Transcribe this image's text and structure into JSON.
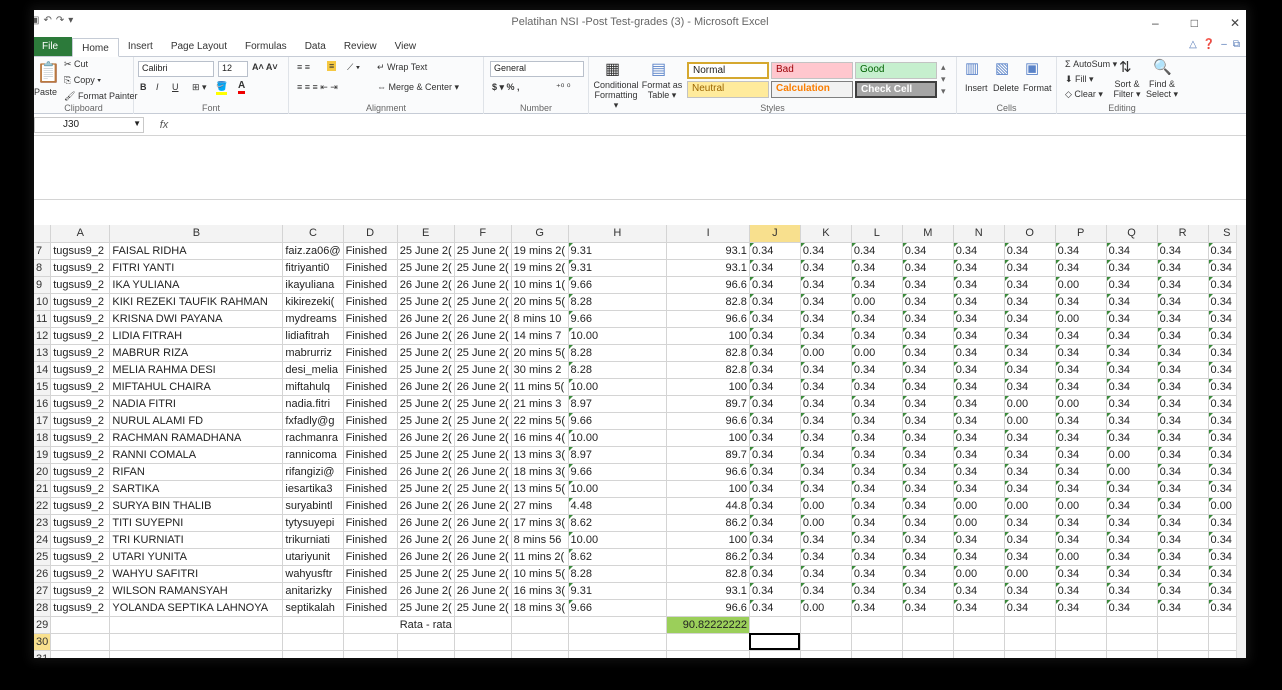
{
  "window": {
    "title": "Pelatihan NSI -Post Test-grades (3) - Microsoft Excel",
    "controls": [
      "–",
      "□",
      "✕"
    ]
  },
  "tabs": [
    "File",
    "Home",
    "Insert",
    "Page Layout",
    "Formulas",
    "Data",
    "Review",
    "View"
  ],
  "active_tab": "Home",
  "ribbon": {
    "clipboard": {
      "paste": "Paste",
      "cut": "Cut",
      "copy": "Copy ▾",
      "format_painter": "Format Painter",
      "label": "Clipboard"
    },
    "font": {
      "name": "Calibri",
      "size": "12",
      "label": "Font",
      "bold": "B",
      "italic": "I",
      "underline": "U"
    },
    "alignment": {
      "wrap": "Wrap Text",
      "merge": "Merge & Center ▾",
      "label": "Alignment"
    },
    "number": {
      "format": "General",
      "currency": "$ ▾  %  ,",
      "label": "Number"
    },
    "styles": {
      "cond": "Conditional Formatting ▾",
      "table": "Format as Table ▾",
      "normal": "Normal",
      "bad": "Bad",
      "good": "Good",
      "neutral": "Neutral",
      "calculation": "Calculation",
      "check": "Check Cell",
      "label": "Styles"
    },
    "cells": {
      "insert": "Insert",
      "delete": "Delete",
      "format": "Format",
      "label": "Cells"
    },
    "editing": {
      "autosum": "Σ AutoSum ▾",
      "fill": "Fill ▾",
      "clear": "Clear ▾",
      "sort": "Sort & Filter ▾",
      "find": "Find & Select ▾",
      "label": "Editing"
    }
  },
  "colors": {
    "file_tab": "#2c7a3a",
    "highlight_header": "#f8e08e",
    "average_fill": "#9bcf5a"
  },
  "formula_bar": {
    "name_box": "J30",
    "fx": "fx",
    "content": ""
  },
  "columns": [
    "A",
    "B",
    "C",
    "D",
    "E",
    "F",
    "G",
    "H",
    "I",
    "J",
    "K",
    "L",
    "M",
    "N",
    "O",
    "P",
    "Q",
    "R",
    "S"
  ],
  "active_column": "J",
  "rows": [
    {
      "r": "7",
      "a": "tugsus9_2",
      "b": "FAISAL RIDHA",
      "c": "faiz.za06@",
      "d": "Finished",
      "e": "25 June 2(",
      "f": "25 June 2(",
      "g": "19 mins 2(",
      "h": "9.31",
      "i": "93.1",
      "s": [
        "0.34",
        "0.34",
        "0.34",
        "0.34",
        "0.34",
        "0.34",
        "0.34",
        "0.34",
        "0.34",
        "0.34"
      ]
    },
    {
      "r": "8",
      "a": "tugsus9_2",
      "b": "FITRI YANTI",
      "c": "fitriyanti0",
      "d": "Finished",
      "e": "25 June 2(",
      "f": "25 June 2(",
      "g": "19 mins 2(",
      "h": "9.31",
      "i": "93.1",
      "s": [
        "0.34",
        "0.34",
        "0.34",
        "0.34",
        "0.34",
        "0.34",
        "0.34",
        "0.34",
        "0.34",
        "0.34"
      ]
    },
    {
      "r": "9",
      "a": "tugsus9_2",
      "b": "IKA YULIANA",
      "c": "ikayuliana",
      "d": "Finished",
      "e": "26 June 2(",
      "f": "26 June 2(",
      "g": "10 mins 1(",
      "h": "9.66",
      "i": "96.6",
      "s": [
        "0.34",
        "0.34",
        "0.34",
        "0.34",
        "0.34",
        "0.34",
        "0.00",
        "0.34",
        "0.34",
        "0.34"
      ]
    },
    {
      "r": "10",
      "a": "tugsus9_2",
      "b": "KIKI REZEKI TAUFIK RAHMAN",
      "c": "kikirezeki(",
      "d": "Finished",
      "e": "25 June 2(",
      "f": "25 June 2(",
      "g": "20 mins 5(",
      "h": "8.28",
      "i": "82.8",
      "s": [
        "0.34",
        "0.34",
        "0.00",
        "0.34",
        "0.34",
        "0.34",
        "0.34",
        "0.34",
        "0.34",
        "0.34"
      ]
    },
    {
      "r": "11",
      "a": "tugsus9_2",
      "b": "KRISNA DWI PAYANA",
      "c": "mydreams",
      "d": "Finished",
      "e": "26 June 2(",
      "f": "26 June 2(",
      "g": "8 mins 10",
      "h": "9.66",
      "i": "96.6",
      "s": [
        "0.34",
        "0.34",
        "0.34",
        "0.34",
        "0.34",
        "0.34",
        "0.00",
        "0.34",
        "0.34",
        "0.34"
      ]
    },
    {
      "r": "12",
      "a": "tugsus9_2",
      "b": "LIDIA FITRAH",
      "c": "lidiafitrah",
      "d": "Finished",
      "e": "26 June 2(",
      "f": "26 June 2(",
      "g": "14 mins 7",
      "h": "10.00",
      "i": "100",
      "s": [
        "0.34",
        "0.34",
        "0.34",
        "0.34",
        "0.34",
        "0.34",
        "0.34",
        "0.34",
        "0.34",
        "0.34"
      ]
    },
    {
      "r": "13",
      "a": "tugsus9_2",
      "b": "MABRUR RIZA",
      "c": "mabrurriz",
      "d": "Finished",
      "e": "25 June 2(",
      "f": "25 June 2(",
      "g": "20 mins 5(",
      "h": "8.28",
      "i": "82.8",
      "s": [
        "0.34",
        "0.00",
        "0.00",
        "0.34",
        "0.34",
        "0.34",
        "0.34",
        "0.34",
        "0.34",
        "0.34"
      ]
    },
    {
      "r": "14",
      "a": "tugsus9_2",
      "b": "MELIA RAHMA DESI",
      "c": "desi_melia",
      "d": "Finished",
      "e": "25 June 2(",
      "f": "25 June 2(",
      "g": "30 mins 2",
      "h": "8.28",
      "i": "82.8",
      "s": [
        "0.34",
        "0.34",
        "0.34",
        "0.34",
        "0.34",
        "0.34",
        "0.34",
        "0.34",
        "0.34",
        "0.34"
      ]
    },
    {
      "r": "15",
      "a": "tugsus9_2",
      "b": "MIFTAHUL CHAIRA",
      "c": "miftahulq",
      "d": "Finished",
      "e": "26 June 2(",
      "f": "26 June 2(",
      "g": "11 mins 5(",
      "h": "10.00",
      "i": "100",
      "s": [
        "0.34",
        "0.34",
        "0.34",
        "0.34",
        "0.34",
        "0.34",
        "0.34",
        "0.34",
        "0.34",
        "0.34"
      ]
    },
    {
      "r": "16",
      "a": "tugsus9_2",
      "b": "NADIA FITRI",
      "c": "nadia.fitri",
      "d": "Finished",
      "e": "25 June 2(",
      "f": "25 June 2(",
      "g": "21 mins 3",
      "h": "8.97",
      "i": "89.7",
      "s": [
        "0.34",
        "0.34",
        "0.34",
        "0.34",
        "0.34",
        "0.00",
        "0.00",
        "0.34",
        "0.34",
        "0.34"
      ]
    },
    {
      "r": "17",
      "a": "tugsus9_2",
      "b": "NURUL ALAMI FD",
      "c": "fxfadly@g",
      "d": "Finished",
      "e": "25 June 2(",
      "f": "25 June 2(",
      "g": "22 mins 5(",
      "h": "9.66",
      "i": "96.6",
      "s": [
        "0.34",
        "0.34",
        "0.34",
        "0.34",
        "0.34",
        "0.00",
        "0.34",
        "0.34",
        "0.34",
        "0.34"
      ]
    },
    {
      "r": "18",
      "a": "tugsus9_2",
      "b": "RACHMAN RAMADHANA",
      "c": "rachmanra",
      "d": "Finished",
      "e": "26 June 2(",
      "f": "26 June 2(",
      "g": "16 mins 4(",
      "h": "10.00",
      "i": "100",
      "s": [
        "0.34",
        "0.34",
        "0.34",
        "0.34",
        "0.34",
        "0.34",
        "0.34",
        "0.34",
        "0.34",
        "0.34"
      ]
    },
    {
      "r": "19",
      "a": "tugsus9_2",
      "b": "RANNI COMALA",
      "c": "rannicoma",
      "d": "Finished",
      "e": "25 June 2(",
      "f": "25 June 2(",
      "g": "13 mins 3(",
      "h": "8.97",
      "i": "89.7",
      "s": [
        "0.34",
        "0.34",
        "0.34",
        "0.34",
        "0.34",
        "0.34",
        "0.34",
        "0.00",
        "0.34",
        "0.34"
      ]
    },
    {
      "r": "20",
      "a": "tugsus9_2",
      "b": "RIFAN",
      "c": "rifangizi@",
      "d": "Finished",
      "e": "26 June 2(",
      "f": "26 June 2(",
      "g": "18 mins 3(",
      "h": "9.66",
      "i": "96.6",
      "s": [
        "0.34",
        "0.34",
        "0.34",
        "0.34",
        "0.34",
        "0.34",
        "0.34",
        "0.00",
        "0.34",
        "0.34"
      ]
    },
    {
      "r": "21",
      "a": "tugsus9_2",
      "b": "SARTIKA",
      "c": "iesartika3",
      "d": "Finished",
      "e": "25 June 2(",
      "f": "25 June 2(",
      "g": "13 mins 5(",
      "h": "10.00",
      "i": "100",
      "s": [
        "0.34",
        "0.34",
        "0.34",
        "0.34",
        "0.34",
        "0.34",
        "0.34",
        "0.34",
        "0.34",
        "0.34"
      ]
    },
    {
      "r": "22",
      "a": "tugsus9_2",
      "b": "SURYA BIN THALIB",
      "c": "suryabintl",
      "d": "Finished",
      "e": "26 June 2(",
      "f": "26 June 2(",
      "g": "27 mins",
      "h": "4.48",
      "i": "44.8",
      "s": [
        "0.34",
        "0.00",
        "0.34",
        "0.34",
        "0.00",
        "0.00",
        "0.00",
        "0.34",
        "0.34",
        "0.00"
      ]
    },
    {
      "r": "23",
      "a": "tugsus9_2",
      "b": "TITI SUYEPNI",
      "c": "tytysuyepi",
      "d": "Finished",
      "e": "26 June 2(",
      "f": "26 June 2(",
      "g": "17 mins 3(",
      "h": "8.62",
      "i": "86.2",
      "s": [
        "0.34",
        "0.00",
        "0.34",
        "0.34",
        "0.00",
        "0.34",
        "0.34",
        "0.34",
        "0.34",
        "0.34"
      ]
    },
    {
      "r": "24",
      "a": "tugsus9_2",
      "b": "TRI KURNIATI",
      "c": "trikurniati",
      "d": "Finished",
      "e": "26 June 2(",
      "f": "26 June 2(",
      "g": "8 mins 56",
      "h": "10.00",
      "i": "100",
      "s": [
        "0.34",
        "0.34",
        "0.34",
        "0.34",
        "0.34",
        "0.34",
        "0.34",
        "0.34",
        "0.34",
        "0.34"
      ]
    },
    {
      "r": "25",
      "a": "tugsus9_2",
      "b": "UTARI YUNITA",
      "c": "utariyunit",
      "d": "Finished",
      "e": "26 June 2(",
      "f": "26 June 2(",
      "g": "11 mins 2(",
      "h": "8.62",
      "i": "86.2",
      "s": [
        "0.34",
        "0.34",
        "0.34",
        "0.34",
        "0.34",
        "0.34",
        "0.00",
        "0.34",
        "0.34",
        "0.34"
      ]
    },
    {
      "r": "26",
      "a": "tugsus9_2",
      "b": "WAHYU SAFITRI",
      "c": "wahyusftr",
      "d": "Finished",
      "e": "25 June 2(",
      "f": "25 June 2(",
      "g": "10 mins 5(",
      "h": "8.28",
      "i": "82.8",
      "s": [
        "0.34",
        "0.34",
        "0.34",
        "0.34",
        "0.00",
        "0.00",
        "0.34",
        "0.34",
        "0.34",
        "0.34"
      ]
    },
    {
      "r": "27",
      "a": "tugsus9_2",
      "b": "WILSON RAMANSYAH",
      "c": "anitarizky",
      "d": "Finished",
      "e": "26 June 2(",
      "f": "26 June 2(",
      "g": "16 mins 3(",
      "h": "9.31",
      "i": "93.1",
      "s": [
        "0.34",
        "0.34",
        "0.34",
        "0.34",
        "0.34",
        "0.34",
        "0.34",
        "0.34",
        "0.34",
        "0.34"
      ]
    },
    {
      "r": "28",
      "a": "tugsus9_2",
      "b": "YOLANDA SEPTIKA LAHNOYA",
      "c": "septikalah",
      "d": "Finished",
      "e": "25 June 2(",
      "f": "25 June 2(",
      "g": "18 mins 3(",
      "h": "9.66",
      "i": "96.6",
      "s": [
        "0.34",
        "0.00",
        "0.34",
        "0.34",
        "0.34",
        "0.34",
        "0.34",
        "0.34",
        "0.34",
        "0.34"
      ]
    }
  ],
  "average_row": {
    "r": "29",
    "label": "Rata - rata",
    "value": "90.82222222"
  },
  "blank_rows": [
    "30",
    "31"
  ],
  "active_cell": "J30"
}
